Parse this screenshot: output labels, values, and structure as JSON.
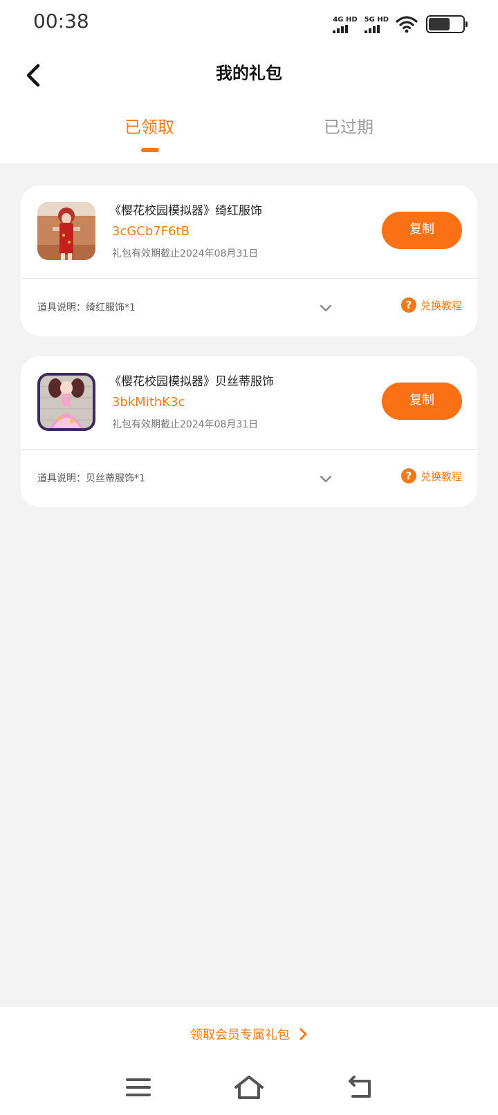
{
  "status_bar": {
    "time": "00:38",
    "network_1": "4G HD",
    "network_2": "5G HD",
    "battery_level": 0.62
  },
  "header": {
    "title": "我的礼包",
    "tabs": [
      {
        "label": "已领取",
        "active": true
      },
      {
        "label": "已过期",
        "active": false
      }
    ]
  },
  "gifts": [
    {
      "name": "《樱花校园模拟器》绮红服饰",
      "code": "3cGCb7F6tB",
      "expiry": "礼包有效期截止2024年08月31日",
      "copy_label": "复制",
      "description": "道具说明：绮红服饰*1",
      "tutorial_label": "兑换教程"
    },
    {
      "name": "《樱花校园模拟器》贝丝蒂服饰",
      "code": "3bkMithK3c",
      "expiry": "礼包有效期截止2024年08月31日",
      "copy_label": "复制",
      "description": "道具说明：贝丝蒂服饰*1",
      "tutorial_label": "兑换教程"
    }
  ],
  "footer": {
    "vip_link_label": "领取会员专属礼包"
  },
  "colors": {
    "accent": "#f07a1a",
    "button": "#fa7014",
    "background": "#f3f3f3"
  },
  "icons": {
    "back": "chevron-left-icon",
    "expand": "chevron-down-icon",
    "help": "question-circle-icon",
    "vip_arrow": "chevron-right-icon",
    "nav_menu": "menu-icon",
    "nav_home": "home-icon",
    "nav_back": "back-icon"
  }
}
